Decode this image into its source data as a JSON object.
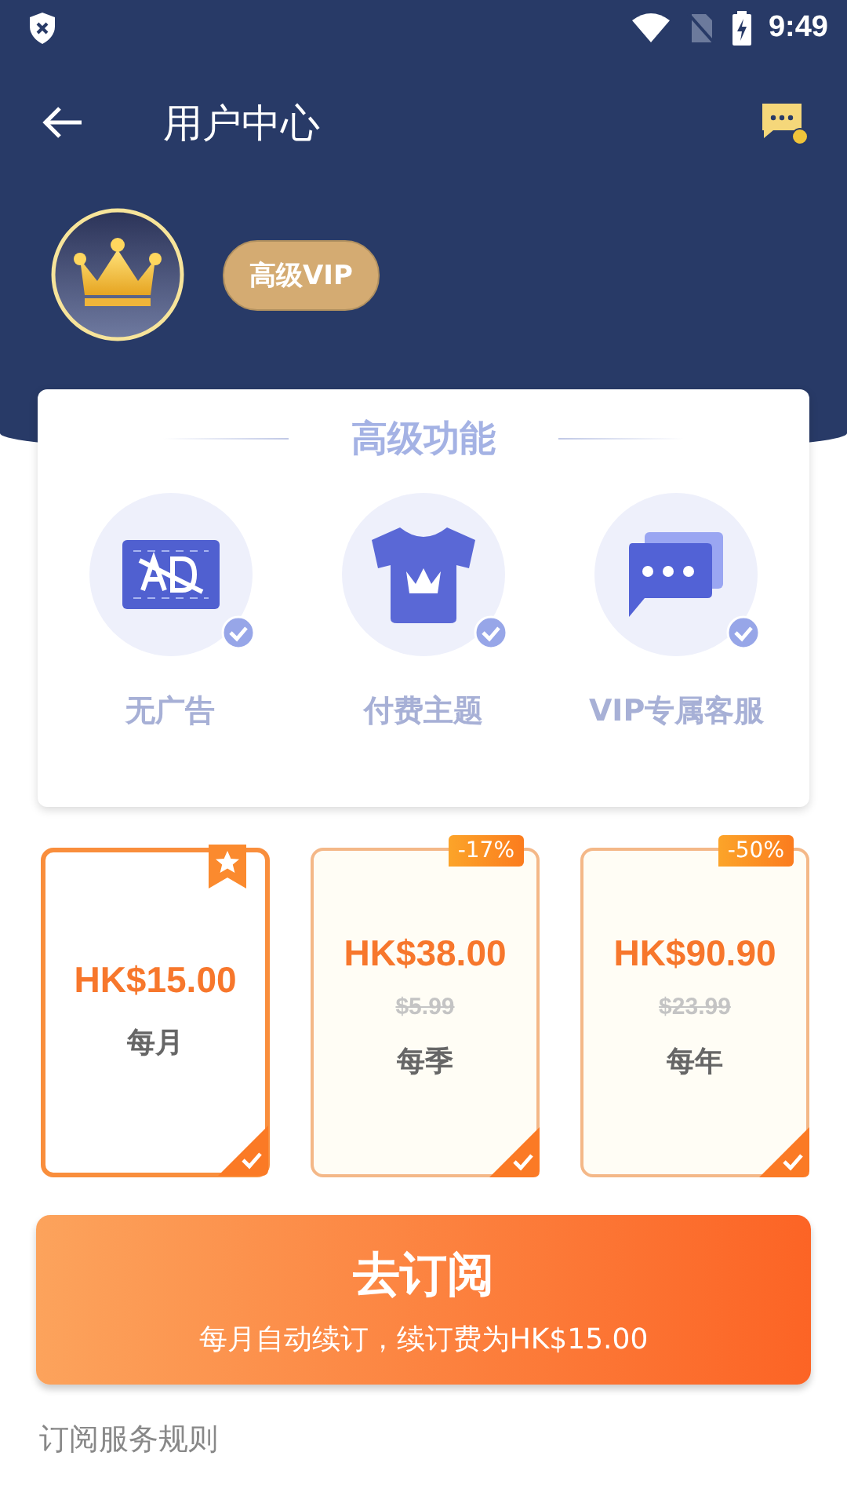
{
  "status_bar": {
    "time": "9:49"
  },
  "toolbar": {
    "title": "用户中心"
  },
  "membership": {
    "badge": "高级VIP"
  },
  "features": {
    "title": "高级功能",
    "items": [
      {
        "kind": "no-ads",
        "label": "无广告",
        "checked": true
      },
      {
        "kind": "theme",
        "label": "付费主题",
        "checked": true
      },
      {
        "kind": "support",
        "label": "VIP专属客服",
        "checked": true
      }
    ]
  },
  "plans": [
    {
      "price": "HK$15.00",
      "period": "每月",
      "starred": true,
      "selected": true
    },
    {
      "price": "HK$38.00",
      "original_price": "$5.99",
      "period": "每季",
      "badge": "-17%",
      "starred": false,
      "selected": false
    },
    {
      "price": "HK$90.90",
      "original_price": "$23.99",
      "period": "每年",
      "badge": "-50%",
      "starred": false,
      "selected": false
    }
  ],
  "subscribe_button": {
    "label": "去订阅",
    "note": "每月自动续订，续订费为HK$15.00"
  },
  "rules": {
    "title": "订阅服务规则"
  }
}
